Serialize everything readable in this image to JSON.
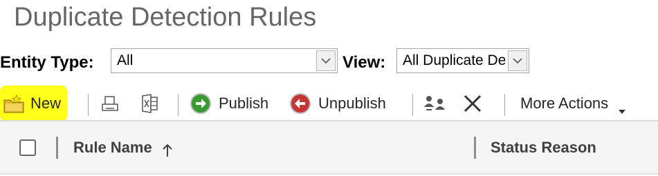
{
  "page": {
    "title": "Duplicate Detection Rules"
  },
  "filters": {
    "entity_type": {
      "label": "Entity Type:",
      "value": "All"
    },
    "view": {
      "label": "View:",
      "value": "All Duplicate De"
    }
  },
  "toolbar": {
    "new_label": "New",
    "publish_label": "Publish",
    "unpublish_label": "Unpublish",
    "more_actions_label": "More Actions",
    "icons": {
      "new": "new-record-icon",
      "print": "print-icon",
      "export": "export-excel-icon",
      "publish": "publish-icon",
      "unpublish": "unpublish-icon",
      "assign": "assign-icon",
      "delete": "delete-icon",
      "more": "chevron-down-icon"
    },
    "highlight_color": "#ffff1a"
  },
  "grid": {
    "columns": [
      {
        "label": "Rule Name",
        "sort": "ascending"
      },
      {
        "label": "Status Reason"
      }
    ]
  }
}
